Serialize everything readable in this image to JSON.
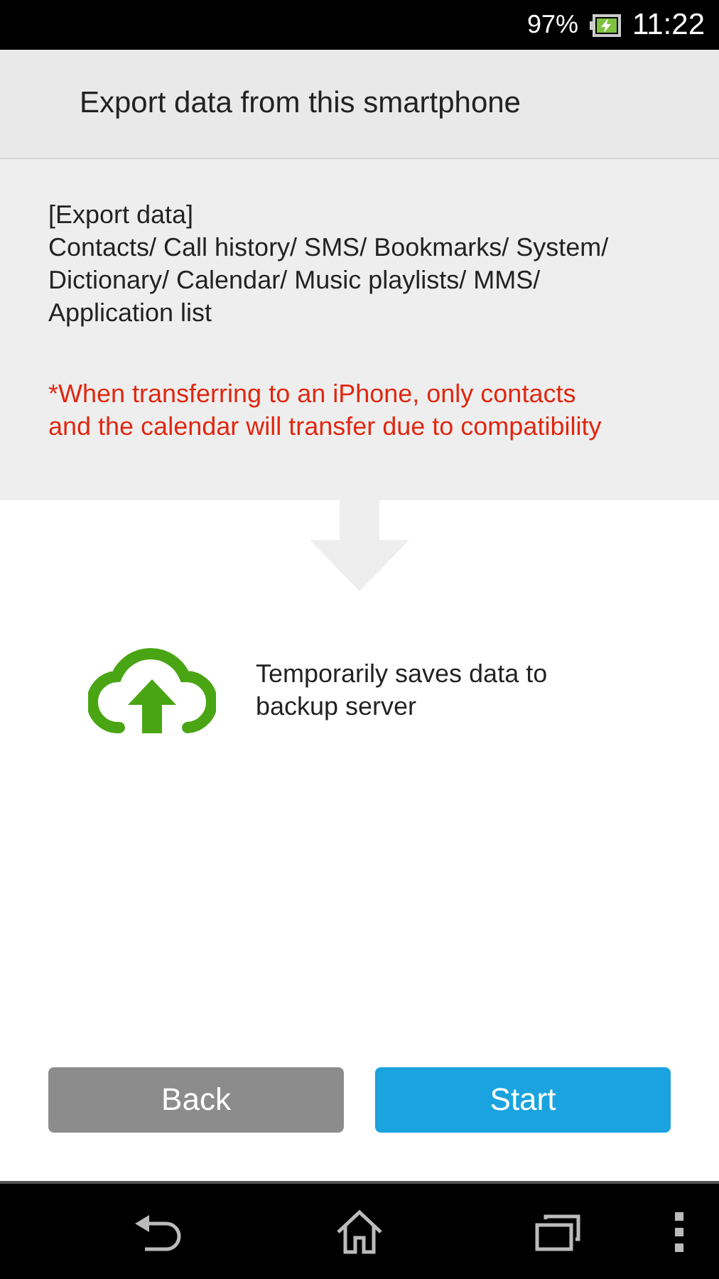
{
  "status_bar": {
    "battery": "97%",
    "time": "11:22"
  },
  "header": {
    "title": "Export data from this smartphone"
  },
  "info": {
    "heading": "[Export data]",
    "items": "Contacts/ Call history/ SMS/ Bookmarks/ System/ Dictionary/ Calendar/ Music playlists/ MMS/ Application list",
    "note": "*When transferring to an iPhone, only contacts and the calendar will transfer due to compatibility"
  },
  "destination": {
    "text": "Temporarily saves data to backup server"
  },
  "buttons": [
    {
      "label": "Back",
      "kind": "secondary"
    },
    {
      "label": "Start",
      "kind": "primary"
    }
  ]
}
